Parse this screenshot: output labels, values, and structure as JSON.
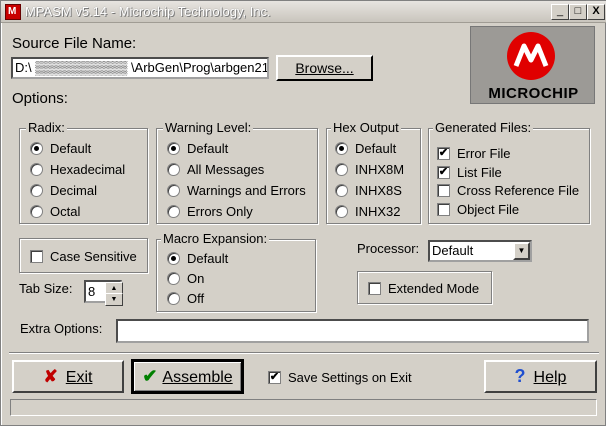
{
  "window": {
    "title": "MPASM v5.14 - Microchip Technology, Inc.",
    "icon_text": "M",
    "controls": {
      "minimize": "_",
      "maximize": "□",
      "close": "X"
    }
  },
  "source": {
    "label": "Source File Name:",
    "path": "D:\\  ▒▒▒▒▒▒▒▒▒▒  \\ArbGen\\Prog\\arbgen21.",
    "browse": "Browse..."
  },
  "logo": {
    "text": "MICROCHIP",
    "color": "#e00000"
  },
  "options_label": "Options:",
  "radix": {
    "title": "Radix:",
    "options": [
      {
        "label": "Default",
        "selected": true
      },
      {
        "label": "Hexadecimal",
        "selected": false
      },
      {
        "label": "Decimal",
        "selected": false
      },
      {
        "label": "Octal",
        "selected": false
      }
    ]
  },
  "warning": {
    "title": "Warning Level:",
    "options": [
      {
        "label": "Default",
        "selected": true
      },
      {
        "label": "All Messages",
        "selected": false
      },
      {
        "label": "Warnings and Errors",
        "selected": false
      },
      {
        "label": "Errors Only",
        "selected": false
      }
    ]
  },
  "hex": {
    "title": "Hex Output",
    "options": [
      {
        "label": "Default",
        "selected": true
      },
      {
        "label": "INHX8M",
        "selected": false
      },
      {
        "label": "INHX8S",
        "selected": false
      },
      {
        "label": "INHX32",
        "selected": false
      }
    ]
  },
  "generated": {
    "title": "Generated Files:",
    "options": [
      {
        "label": "Error File",
        "checked": true
      },
      {
        "label": "List File",
        "checked": true
      },
      {
        "label": "Cross Reference File",
        "checked": false
      },
      {
        "label": "Object File",
        "checked": false
      }
    ]
  },
  "case_sensitive": {
    "label": "Case Sensitive",
    "checked": false
  },
  "macro": {
    "title": "Macro Expansion:",
    "options": [
      {
        "label": "Default",
        "selected": true
      },
      {
        "label": "On",
        "selected": false
      },
      {
        "label": "Off",
        "selected": false
      }
    ]
  },
  "processor": {
    "label": "Processor:",
    "value": "Default"
  },
  "extended": {
    "label": "Extended Mode",
    "checked": false
  },
  "tab_size": {
    "label": "Tab Size:",
    "value": "8"
  },
  "extra_options": {
    "label": "Extra Options:",
    "value": ""
  },
  "buttons": {
    "exit": "Exit",
    "assemble": "Assemble",
    "help": "Help"
  },
  "save_settings": {
    "label": "Save Settings on Exit",
    "checked": true
  },
  "colors": {
    "exit_icon": "#c00000",
    "assemble_icon": "#008000",
    "help_icon": "#1f4fd0"
  }
}
